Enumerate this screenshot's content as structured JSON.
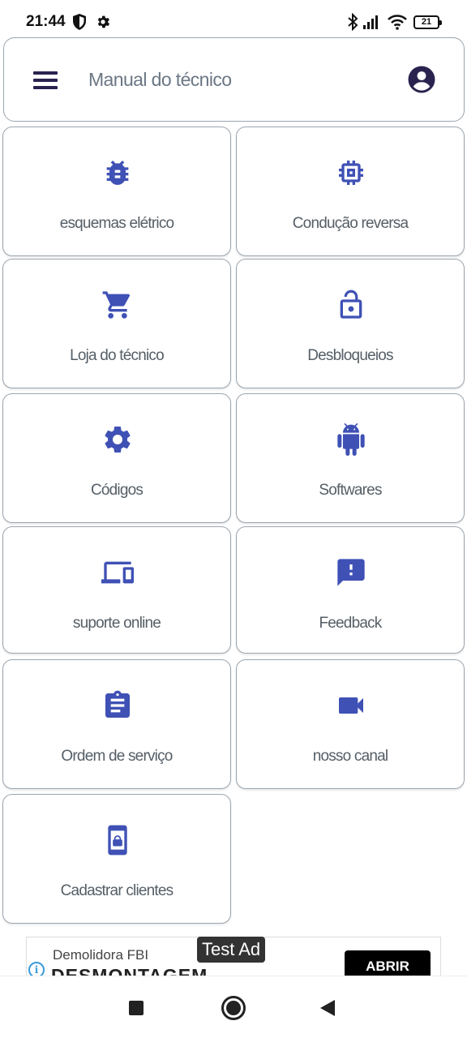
{
  "status_bar": {
    "time": "21:44",
    "battery": "21",
    "icons": [
      "shield-icon",
      "gear-icon",
      "bluetooth-icon",
      "signal-icon",
      "wifi-icon",
      "battery-icon"
    ]
  },
  "app_bar": {
    "title": "Manual do técnico",
    "menu_icon": "hamburger-menu-icon",
    "account_icon": "account-circle-icon"
  },
  "colors": {
    "accent": "#3f51b5",
    "title_text": "#6b7785",
    "tile_border": "#9aa4ad",
    "menu_icon": "#2a234f"
  },
  "tiles": [
    {
      "label": "esquemas elétrico",
      "icon": "bug-icon"
    },
    {
      "label": "Condução reversa",
      "icon": "chip-icon"
    },
    {
      "label": "Loja do técnico",
      "icon": "cart-icon"
    },
    {
      "label": "Desbloqueios",
      "icon": "lock-open-icon"
    },
    {
      "label": "Códigos",
      "icon": "gear-icon"
    },
    {
      "label": "Softwares",
      "icon": "android-icon"
    },
    {
      "label": "suporte online",
      "icon": "devices-icon"
    },
    {
      "label": "Feedback",
      "icon": "feedback-icon"
    },
    {
      "label": "Ordem de serviço",
      "icon": "clipboard-icon"
    },
    {
      "label": "nosso canal",
      "icon": "video-camera-icon"
    },
    {
      "label": "Cadastrar clientes",
      "icon": "phone-lock-icon"
    }
  ],
  "ad": {
    "test_label": "Test Ad",
    "brand": "Demolidora FBI",
    "headline": "DESMONTAGEM",
    "cta": "ABRIR",
    "info_glyph": "i"
  }
}
